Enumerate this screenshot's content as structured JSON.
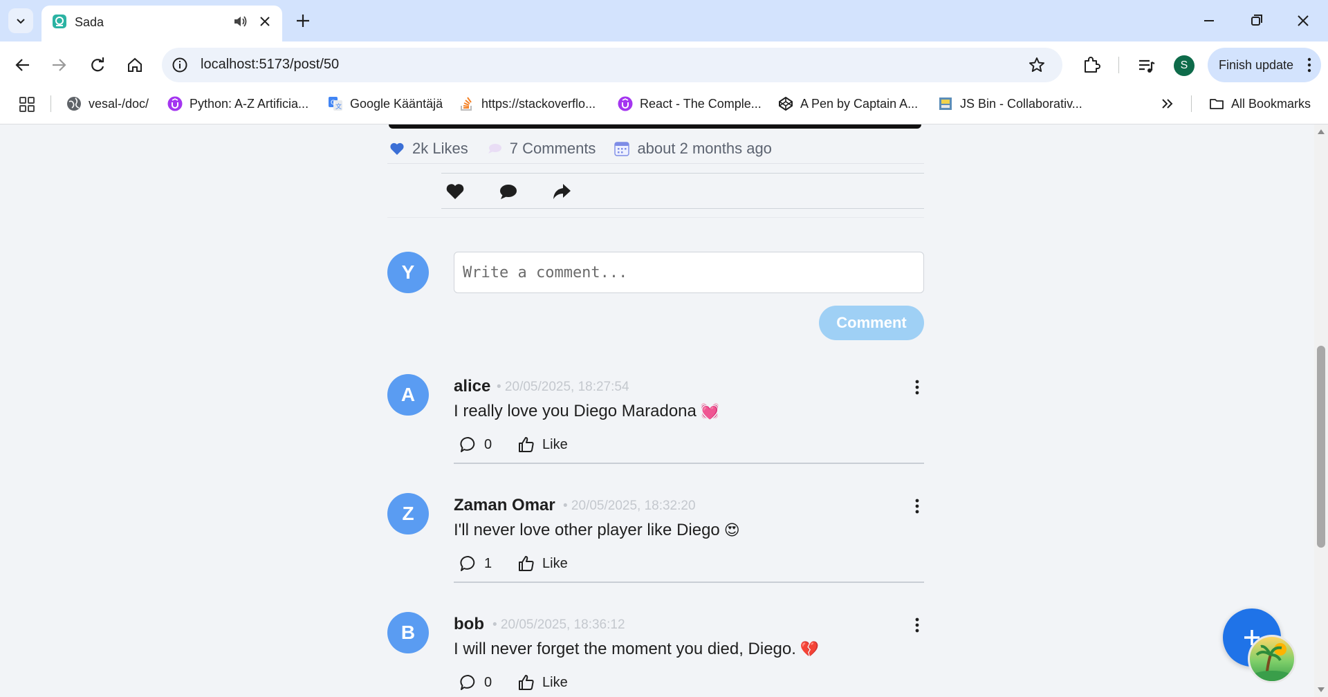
{
  "browser": {
    "tab_title": "Sada",
    "url": "localhost:5173/post/50",
    "profile_initial": "S",
    "finish_update_label": "Finish update",
    "bookmarks": [
      {
        "label": "vesal-/doc/",
        "icon": "globe-icon"
      },
      {
        "label": "Python: A-Z Artificia...",
        "icon": "udemy-icon"
      },
      {
        "label": "Google Kääntäjä",
        "icon": "google-translate-icon"
      },
      {
        "label": "https://stackoverflo...",
        "icon": "stackoverflow-icon"
      },
      {
        "label": "React - The Comple...",
        "icon": "udemy-icon"
      },
      {
        "label": "A Pen by Captain A...",
        "icon": "codepen-icon"
      },
      {
        "label": "JS Bin - Collaborativ...",
        "icon": "jsbin-icon"
      }
    ],
    "all_bookmarks_label": "All Bookmarks"
  },
  "post": {
    "likes_label": "2k Likes",
    "comments_label": "7 Comments",
    "time_label": "about 2 months ago"
  },
  "composer": {
    "avatar_initial": "Y",
    "placeholder": "Write a comment...",
    "submit_label": "Comment"
  },
  "comments": [
    {
      "initial": "A",
      "author": "alice",
      "time": "• 20/05/2025, 18:27:54",
      "text": "I really love you Diego Maradona",
      "emoji": "💓",
      "replies": "0",
      "like_label": "Like"
    },
    {
      "initial": "Z",
      "author": "Zaman Omar",
      "time": "• 20/05/2025, 18:32:20",
      "text": "I'll never love other player like Diego",
      "emoji": "😍",
      "replies": "1",
      "like_label": "Like"
    },
    {
      "initial": "B",
      "author": "bob",
      "time": "• 20/05/2025, 18:36:12",
      "text": "I will never forget the moment you died, Diego.",
      "emoji": "💔",
      "replies": "0",
      "like_label": "Like"
    }
  ],
  "colors": {
    "accent": "#1f73e8",
    "avatar": "#5a9cf2",
    "comment_button_disabled": "#9fd0f5"
  }
}
